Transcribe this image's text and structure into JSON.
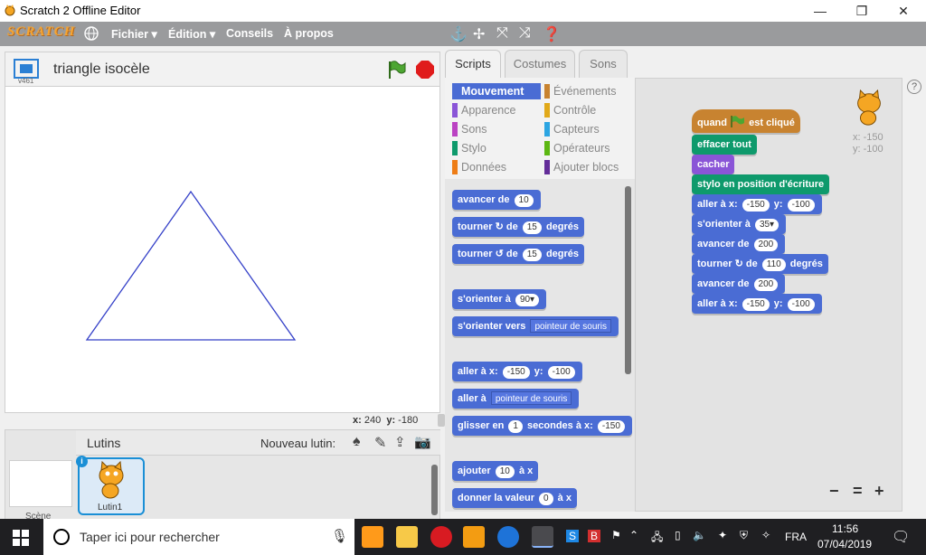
{
  "window": {
    "title": "Scratch 2 Offline Editor",
    "minimize": "—",
    "maximize": "❐",
    "close": "✕"
  },
  "menu": {
    "logo": "SCRATCH",
    "file": "Fichier ▾",
    "edit": "Édition ▾",
    "tips": "Conseils",
    "about": "À propos"
  },
  "stage": {
    "project_title": "triangle isocèle",
    "version": "v461",
    "x_label": "x:",
    "x": "240",
    "y_label": "y:",
    "y": "-180"
  },
  "sprites_panel": {
    "title": "Lutins",
    "new_sprite": "Nouveau lutin:",
    "scene_label": "Scène",
    "sprite_name": "Lutin1",
    "sprite_badge": "i"
  },
  "tabs": {
    "scripts": "Scripts",
    "costumes": "Costumes",
    "sounds": "Sons"
  },
  "categories": {
    "left": [
      "Mouvement",
      "Apparence",
      "Sons",
      "Stylo",
      "Données"
    ],
    "right": [
      "Événements",
      "Contrôle",
      "Capteurs",
      "Opérateurs",
      "Ajouter blocs"
    ],
    "left_colors": [
      "#4a6cd4",
      "#8a55d7",
      "#bb42c3",
      "#0e9a6c",
      "#ee7d16"
    ],
    "right_colors": [
      "#c88330",
      "#e1a91a",
      "#2ca5e2",
      "#5cb712",
      "#632d99"
    ]
  },
  "palette": {
    "b1": {
      "text": "avancer de",
      "v": "10"
    },
    "b2": {
      "a": "tourner",
      "sym": "↻",
      "b": "de",
      "v": "15",
      "c": "degrés"
    },
    "b3": {
      "a": "tourner",
      "sym": "↺",
      "b": "de",
      "v": "15",
      "c": "degrés"
    },
    "b4": {
      "a": "s'orienter à",
      "v": "90▾"
    },
    "b5": {
      "a": "s'orienter vers",
      "v": "pointeur de souris"
    },
    "b6": {
      "a": "aller à x:",
      "x": "-150",
      "b": "y:",
      "y": "-100"
    },
    "b7": {
      "a": "aller à",
      "v": "pointeur de souris"
    },
    "b8": {
      "a": "glisser en",
      "v": "1",
      "b": "secondes à x:",
      "x": "-150"
    },
    "b9": {
      "a": "ajouter",
      "v": "10",
      "b": "à x"
    },
    "b10": {
      "a": "donner la valeur",
      "v": "0",
      "b": "à x"
    }
  },
  "script": {
    "s1": {
      "a": "quand",
      "b": "est cliqué"
    },
    "s2": "effacer tout",
    "s3": "cacher",
    "s4": "stylo en position d'écriture",
    "s5": {
      "a": "aller à x:",
      "x": "-150",
      "b": "y:",
      "y": "-100"
    },
    "s6": {
      "a": "s'orienter à",
      "v": "35▾"
    },
    "s7": {
      "a": "avancer de",
      "v": "200"
    },
    "s8": {
      "a": "tourner",
      "sym": "↻",
      "b": "de",
      "v": "110",
      "c": "degrés"
    },
    "s9": {
      "a": "avancer de",
      "v": "200"
    },
    "s10": {
      "a": "aller à x:",
      "x": "-150",
      "b": "y:",
      "y": "-100"
    },
    "sprite_x": "x: -150",
    "sprite_y": "y: -100"
  },
  "zoom": {
    "out": "−",
    "reset": "=",
    "in": "+"
  },
  "help": "?",
  "taskbar": {
    "search": "Taper ici pour rechercher",
    "lang": "FRA",
    "time": "11:56",
    "date": "07/04/2019"
  }
}
